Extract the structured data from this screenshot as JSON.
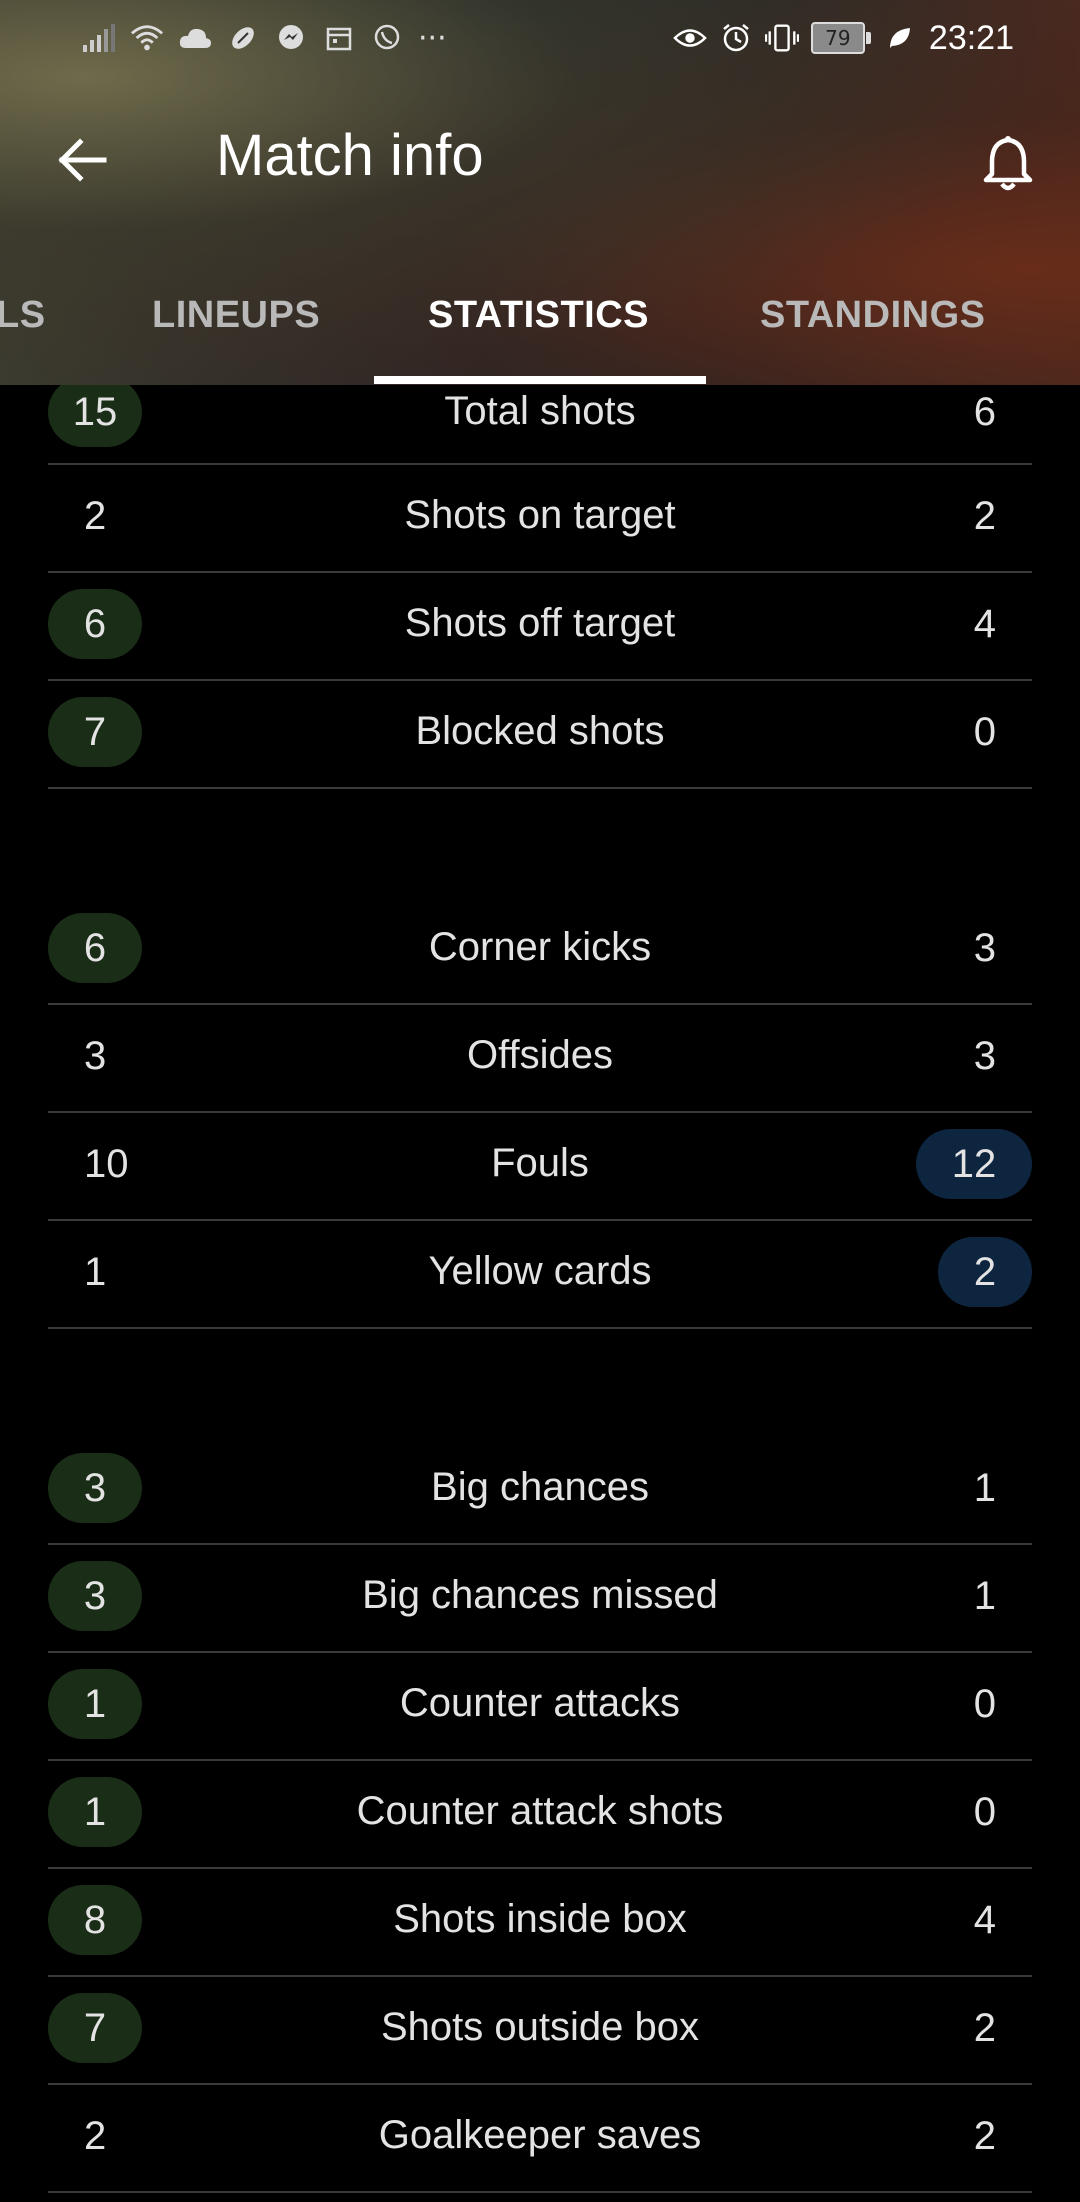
{
  "status_bar": {
    "time": "23:21",
    "battery": "79",
    "more": "···"
  },
  "toolbar": {
    "title": "Match info"
  },
  "tabs": [
    {
      "label": "LS"
    },
    {
      "label": "LINEUPS"
    },
    {
      "label": "STATISTICS",
      "active": true
    },
    {
      "label": "STANDINGS"
    }
  ],
  "colors": {
    "home_highlight": "#1a2d16",
    "away_highlight": "#0e2540",
    "divider": "#3a3a3a",
    "background": "#000000"
  },
  "stats": [
    {
      "label": "Total shots",
      "home": "15",
      "away": "6",
      "highlight": "home"
    },
    {
      "label": "Shots on target",
      "home": "2",
      "away": "2",
      "highlight": "none"
    },
    {
      "label": "Shots off target",
      "home": "6",
      "away": "4",
      "highlight": "home"
    },
    {
      "label": "Blocked shots",
      "home": "7",
      "away": "0",
      "highlight": "home"
    },
    {
      "label": "Corner kicks",
      "home": "6",
      "away": "3",
      "highlight": "home"
    },
    {
      "label": "Offsides",
      "home": "3",
      "away": "3",
      "highlight": "none"
    },
    {
      "label": "Fouls",
      "home": "10",
      "away": "12",
      "highlight": "away"
    },
    {
      "label": "Yellow cards",
      "home": "1",
      "away": "2",
      "highlight": "away"
    },
    {
      "label": "Big chances",
      "home": "3",
      "away": "1",
      "highlight": "home"
    },
    {
      "label": "Big chances missed",
      "home": "3",
      "away": "1",
      "highlight": "home"
    },
    {
      "label": "Counter attacks",
      "home": "1",
      "away": "0",
      "highlight": "home"
    },
    {
      "label": "Counter attack shots",
      "home": "1",
      "away": "0",
      "highlight": "home"
    },
    {
      "label": "Shots inside box",
      "home": "8",
      "away": "4",
      "highlight": "home"
    },
    {
      "label": "Shots outside box",
      "home": "7",
      "away": "2",
      "highlight": "home"
    },
    {
      "label": "Goalkeeper saves",
      "home": "2",
      "away": "2",
      "highlight": "none"
    }
  ]
}
